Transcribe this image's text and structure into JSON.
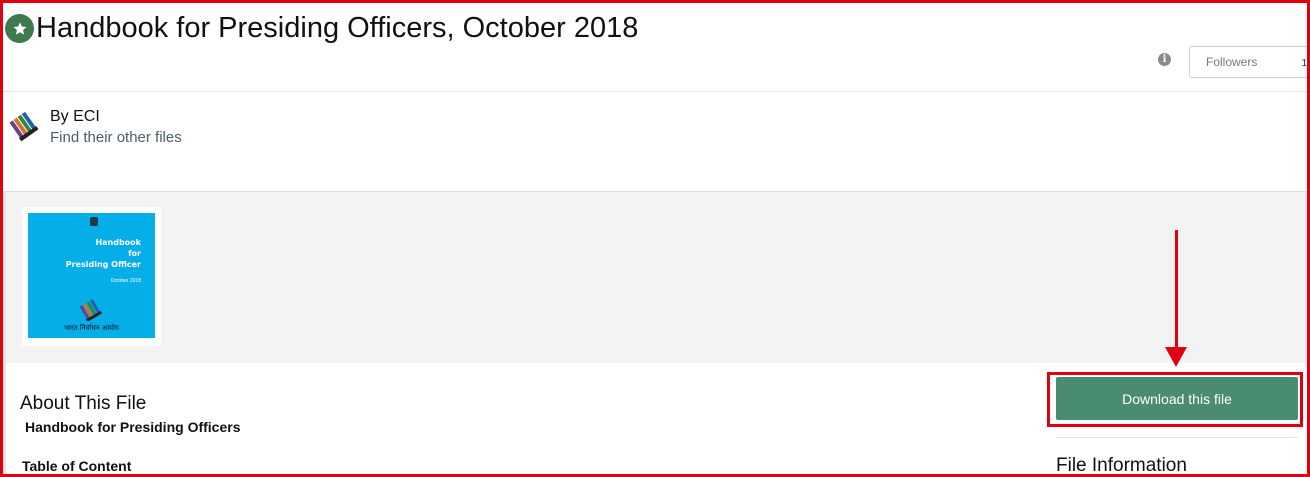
{
  "header": {
    "title": "Handbook for Presiding Officers, October 2018",
    "badge_icon": "star-icon",
    "info_icon": "info-icon",
    "followers_label": "Followers",
    "followers_count": "1"
  },
  "author": {
    "by_label": "By ECI",
    "other_files_link": "Find their other files",
    "avatar_icon": "eci-voting-logo-icon"
  },
  "gallery": {
    "thumbnail": {
      "title_lines": [
        "Handbook",
        "for",
        "Presiding Officer"
      ],
      "date_text": "October 2018",
      "footer_text": "भारत निर्वाचन आयोग",
      "background_color": "#05aee8"
    }
  },
  "about": {
    "heading": "About This File",
    "subtitle": "Handbook for Presiding Officers",
    "toc_heading": "Table of Content"
  },
  "sidebar": {
    "download_label": "Download this file",
    "file_info_heading": "File Information"
  },
  "colors": {
    "annotation_red": "#e0000f",
    "download_green": "#4a8c70",
    "badge_green": "#3d7a4e"
  }
}
